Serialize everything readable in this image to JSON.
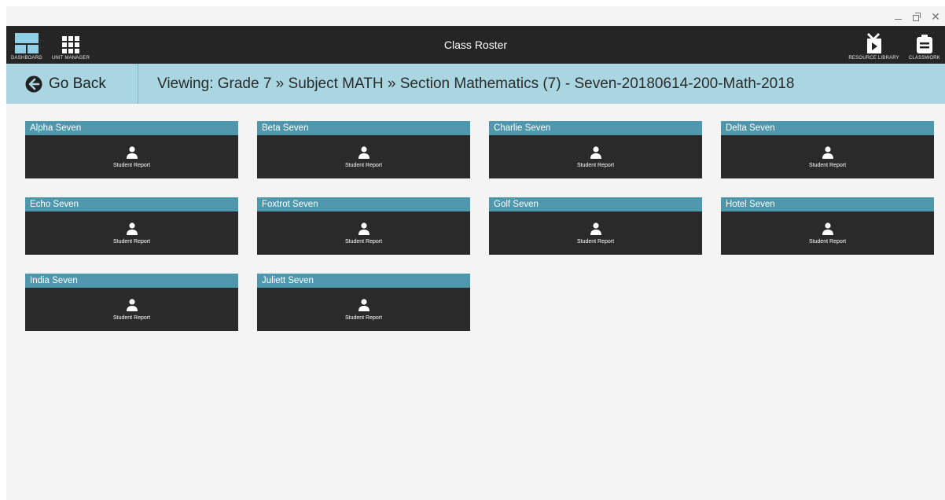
{
  "window": {
    "controls": {
      "minimize": "minimize",
      "restore": "restore",
      "close": "✕"
    }
  },
  "topbar": {
    "title": "Class Roster",
    "nav_left": [
      {
        "label": "DASHBOARD",
        "icon": "dashboard-icon"
      },
      {
        "label": "UNIT MANAGER",
        "icon": "grid-icon"
      }
    ],
    "nav_right": [
      {
        "label": "RESOURCE LIBRARY",
        "icon": "video-folder-icon"
      },
      {
        "label": "CLASSWORK",
        "icon": "clipboard-icon"
      }
    ]
  },
  "breadcrumb": {
    "back_label": "Go Back",
    "viewing": "Viewing: Grade 7 » Subject MATH » Section Mathematics (7) - Seven-20180614-200-Math-2018"
  },
  "students": [
    {
      "name": "Alpha Seven",
      "report_label": "Student Report"
    },
    {
      "name": "Beta Seven",
      "report_label": "Student Report"
    },
    {
      "name": "Charlie Seven",
      "report_label": "Student Report"
    },
    {
      "name": "Delta Seven",
      "report_label": "Student Report"
    },
    {
      "name": "Echo Seven",
      "report_label": "Student Report"
    },
    {
      "name": "Foxtrot Seven",
      "report_label": "Student Report"
    },
    {
      "name": "Golf Seven",
      "report_label": "Student Report"
    },
    {
      "name": "Hotel Seven",
      "report_label": "Student Report"
    },
    {
      "name": "India Seven",
      "report_label": "Student Report"
    },
    {
      "name": "Juliett Seven",
      "report_label": "Student Report"
    }
  ],
  "colors": {
    "topbar_bg": "#252525",
    "breadcrumb_bg": "#a9d6e1",
    "card_header": "#4e97ac",
    "card_body": "#2a2a2a",
    "dashboard_icon_accent": "#8fd0e6"
  }
}
